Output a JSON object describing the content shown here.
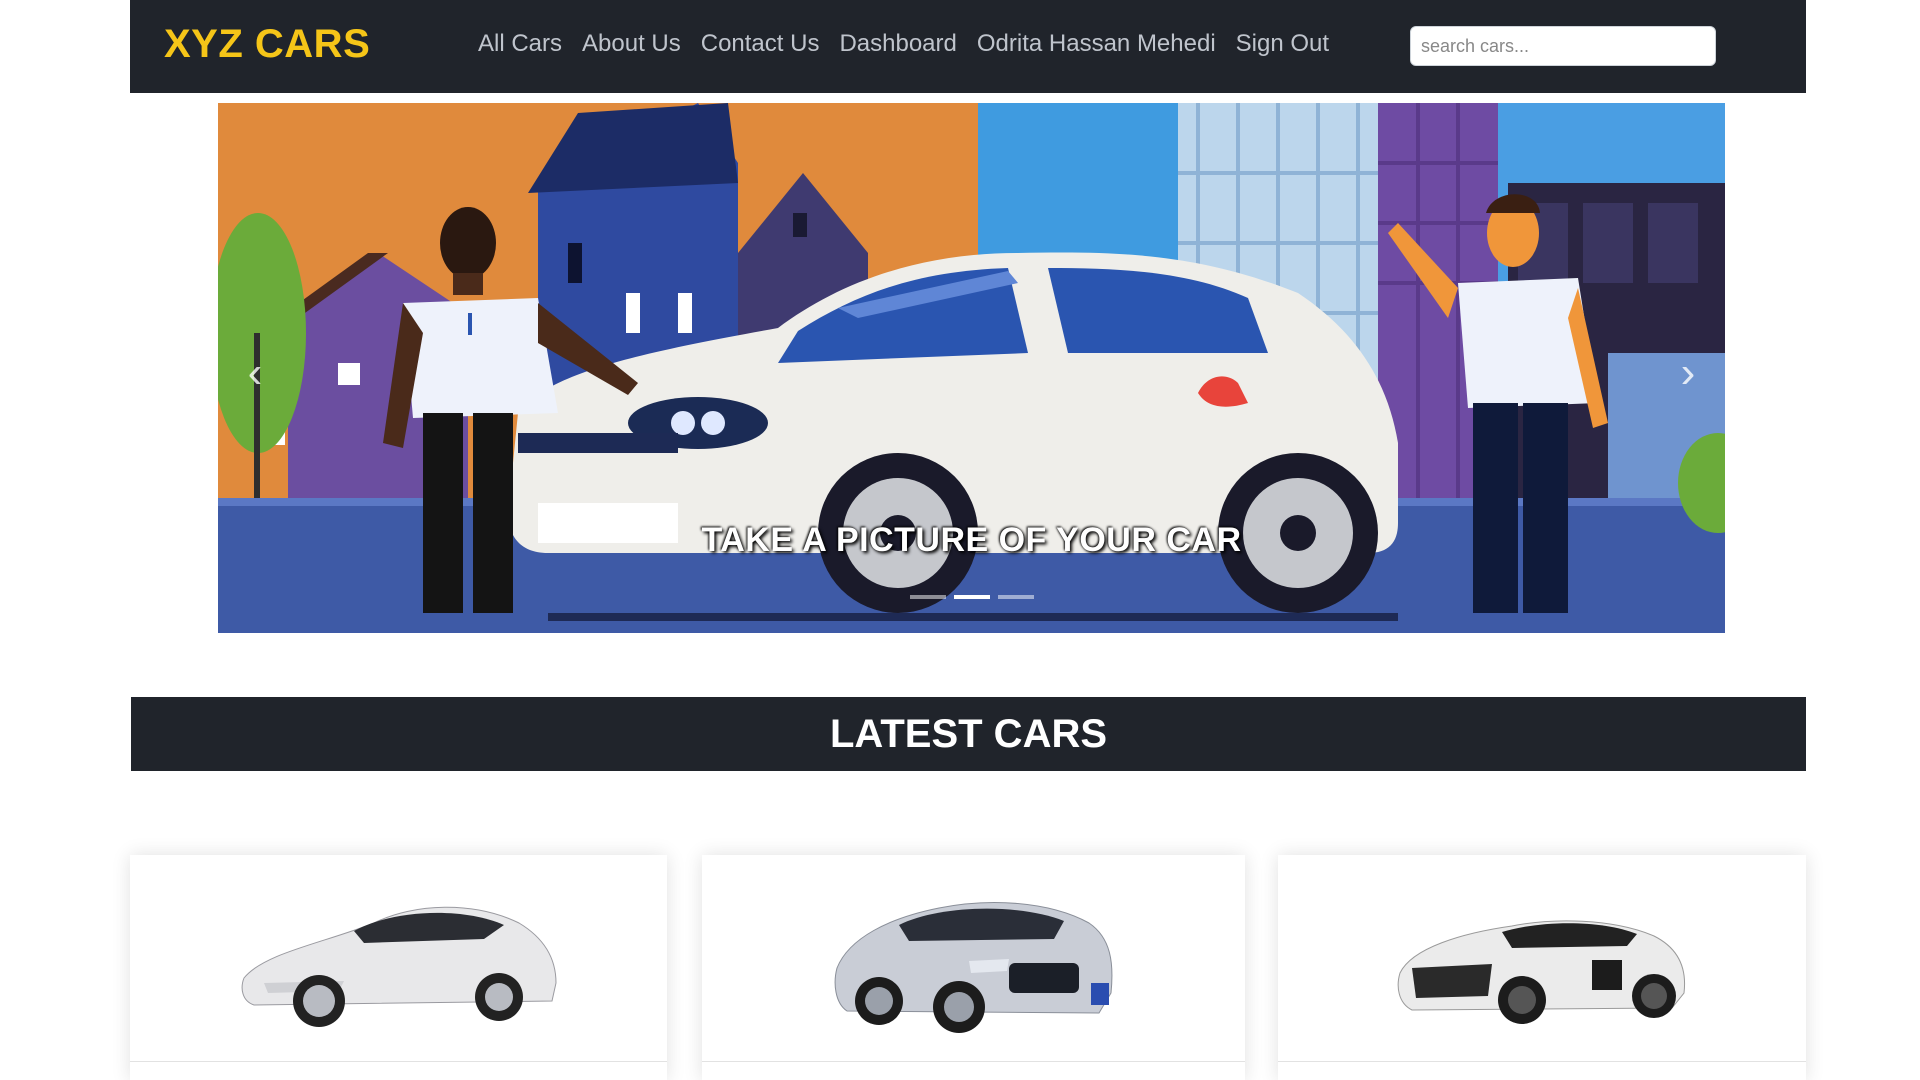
{
  "navbar": {
    "brand": "XYZ CARS",
    "links": [
      "All Cars",
      "About Us",
      "Contact Us",
      "Dashboard",
      "Odrita Hassan Mehedi",
      "Sign Out"
    ],
    "search_placeholder": "search cars...",
    "colors": {
      "background": "#20242b",
      "brand": "#f5c518",
      "link": "#bfc4cc"
    }
  },
  "carousel": {
    "caption": "TAKE A PICTURE OF YOUR CAR",
    "prev_icon": "chevron-left-icon",
    "next_icon": "chevron-right-icon",
    "slide_count": 3,
    "active_slide": 2
  },
  "latest_section": {
    "title": "LATEST CARS"
  },
  "cars": [
    {
      "image": "white-sedan",
      "color": "#e8e8ea"
    },
    {
      "image": "silver-sedan",
      "color": "#c9cdd6"
    },
    {
      "image": "white-sports-car",
      "color": "#ebebeb"
    }
  ]
}
